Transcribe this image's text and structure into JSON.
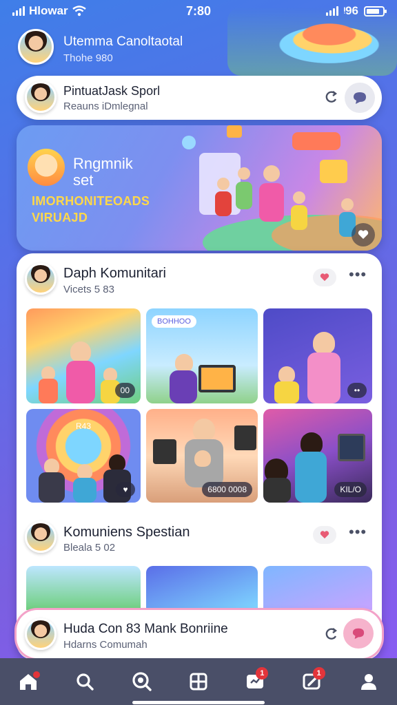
{
  "status_bar": {
    "carrier": "Hlowar",
    "time": "7:80",
    "network": "ᵎ96"
  },
  "header": {
    "title": "Utemma Canoltaotal",
    "subtitle": "Thohe 980"
  },
  "pill_card": {
    "title": "Pintua⁠tJask Sporl",
    "subtitle": "Reauns iDmlegnal"
  },
  "banner": {
    "title_line1": "Rngmnik",
    "title_line2": "set",
    "subtitle_line1": "IMORHONITEOADS",
    "subtitle_line2": "VIRUAJD"
  },
  "section1": {
    "title": "Daph Komunitari",
    "subtitle": "Vicets 5 83",
    "tiles": [
      {
        "badge": "00"
      },
      {
        "label": "BOHHOO",
        "badge": ""
      },
      {
        "badge": "••"
      },
      {
        "label": "R43",
        "badge": "♥"
      },
      {
        "badge": "6800 0008"
      },
      {
        "badge": "KIL/O"
      }
    ]
  },
  "section2": {
    "title": "Komuniens Spestian",
    "subtitle": "Bleala 5 02"
  },
  "input_pill": {
    "title": "Huda Con 83 Mank Bonriine",
    "subtitle": "Hdarns Comumah"
  },
  "nav": [
    {
      "icon": "home-icon",
      "badge": ""
    },
    {
      "icon": "search-icon",
      "badge": ""
    },
    {
      "icon": "explore-icon",
      "badge": ""
    },
    {
      "icon": "grid-icon",
      "badge": ""
    },
    {
      "icon": "media-icon",
      "badge": "1"
    },
    {
      "icon": "edit-icon",
      "badge": "1"
    },
    {
      "icon": "profile-icon",
      "badge": ""
    }
  ],
  "colors": {
    "accent": "#5a6ee8",
    "nav_bg": "#4a4f68",
    "badge": "#e3343a",
    "banner_text": "#ffd84a"
  }
}
